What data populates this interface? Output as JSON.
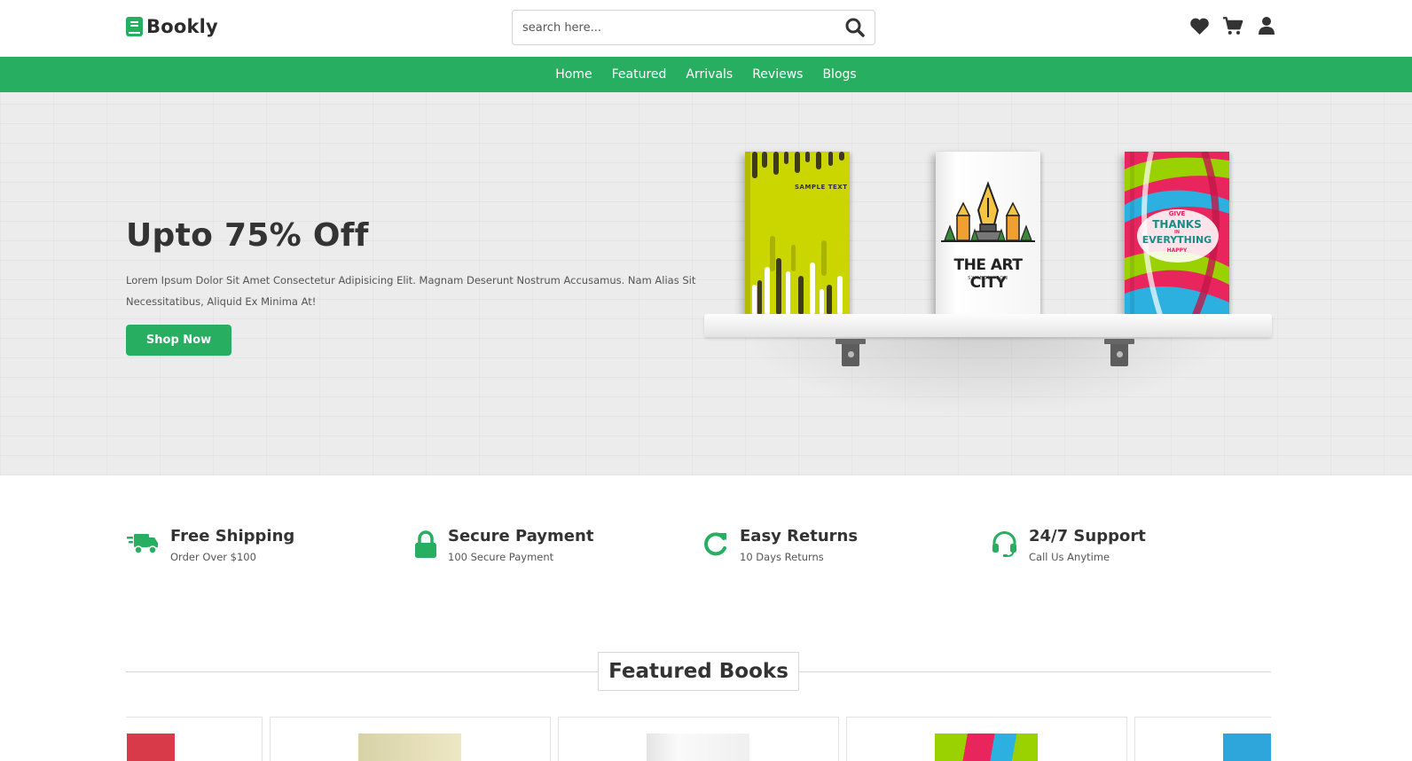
{
  "brand": {
    "name": "Bookly",
    "accent_color": "#27ae60"
  },
  "search": {
    "placeholder": "search here..."
  },
  "header_icons": [
    "heart-icon",
    "cart-icon",
    "user-icon"
  ],
  "nav": {
    "items": [
      "Home",
      "Featured",
      "Arrivals",
      "Reviews",
      "Blogs"
    ]
  },
  "hero": {
    "title": "Upto 75% Off",
    "text": "Lorem Ipsum Dolor Sit Amet Consectetur Adipisicing Elit. Magnam Deserunt Nostrum Accusamus. Nam Alias Sit Necessitatibus, Aliquid Ex Minima At!",
    "button_label": "Shop Now",
    "books": [
      {
        "cover_text": "SAMPLE TEXT"
      },
      {
        "cover_text": "THE ART CITY",
        "cover_subtext": "SYMBOL ICON"
      },
      {
        "cover_text_lines": [
          "GIVE",
          "THANKS",
          "IN",
          "EVERYTHING",
          "HAPPY"
        ]
      }
    ]
  },
  "features": [
    {
      "icon": "truck-icon",
      "title": "Free Shipping",
      "subtitle": "Order Over $100"
    },
    {
      "icon": "lock-icon",
      "title": "Secure Payment",
      "subtitle": "100 Secure Payment"
    },
    {
      "icon": "redo-icon",
      "title": "Easy Returns",
      "subtitle": "10 Days Returns"
    },
    {
      "icon": "headset-icon",
      "title": "24/7 Support",
      "subtitle": "Call Us Anytime"
    }
  ],
  "featured_books": {
    "title": "Featured Books"
  }
}
